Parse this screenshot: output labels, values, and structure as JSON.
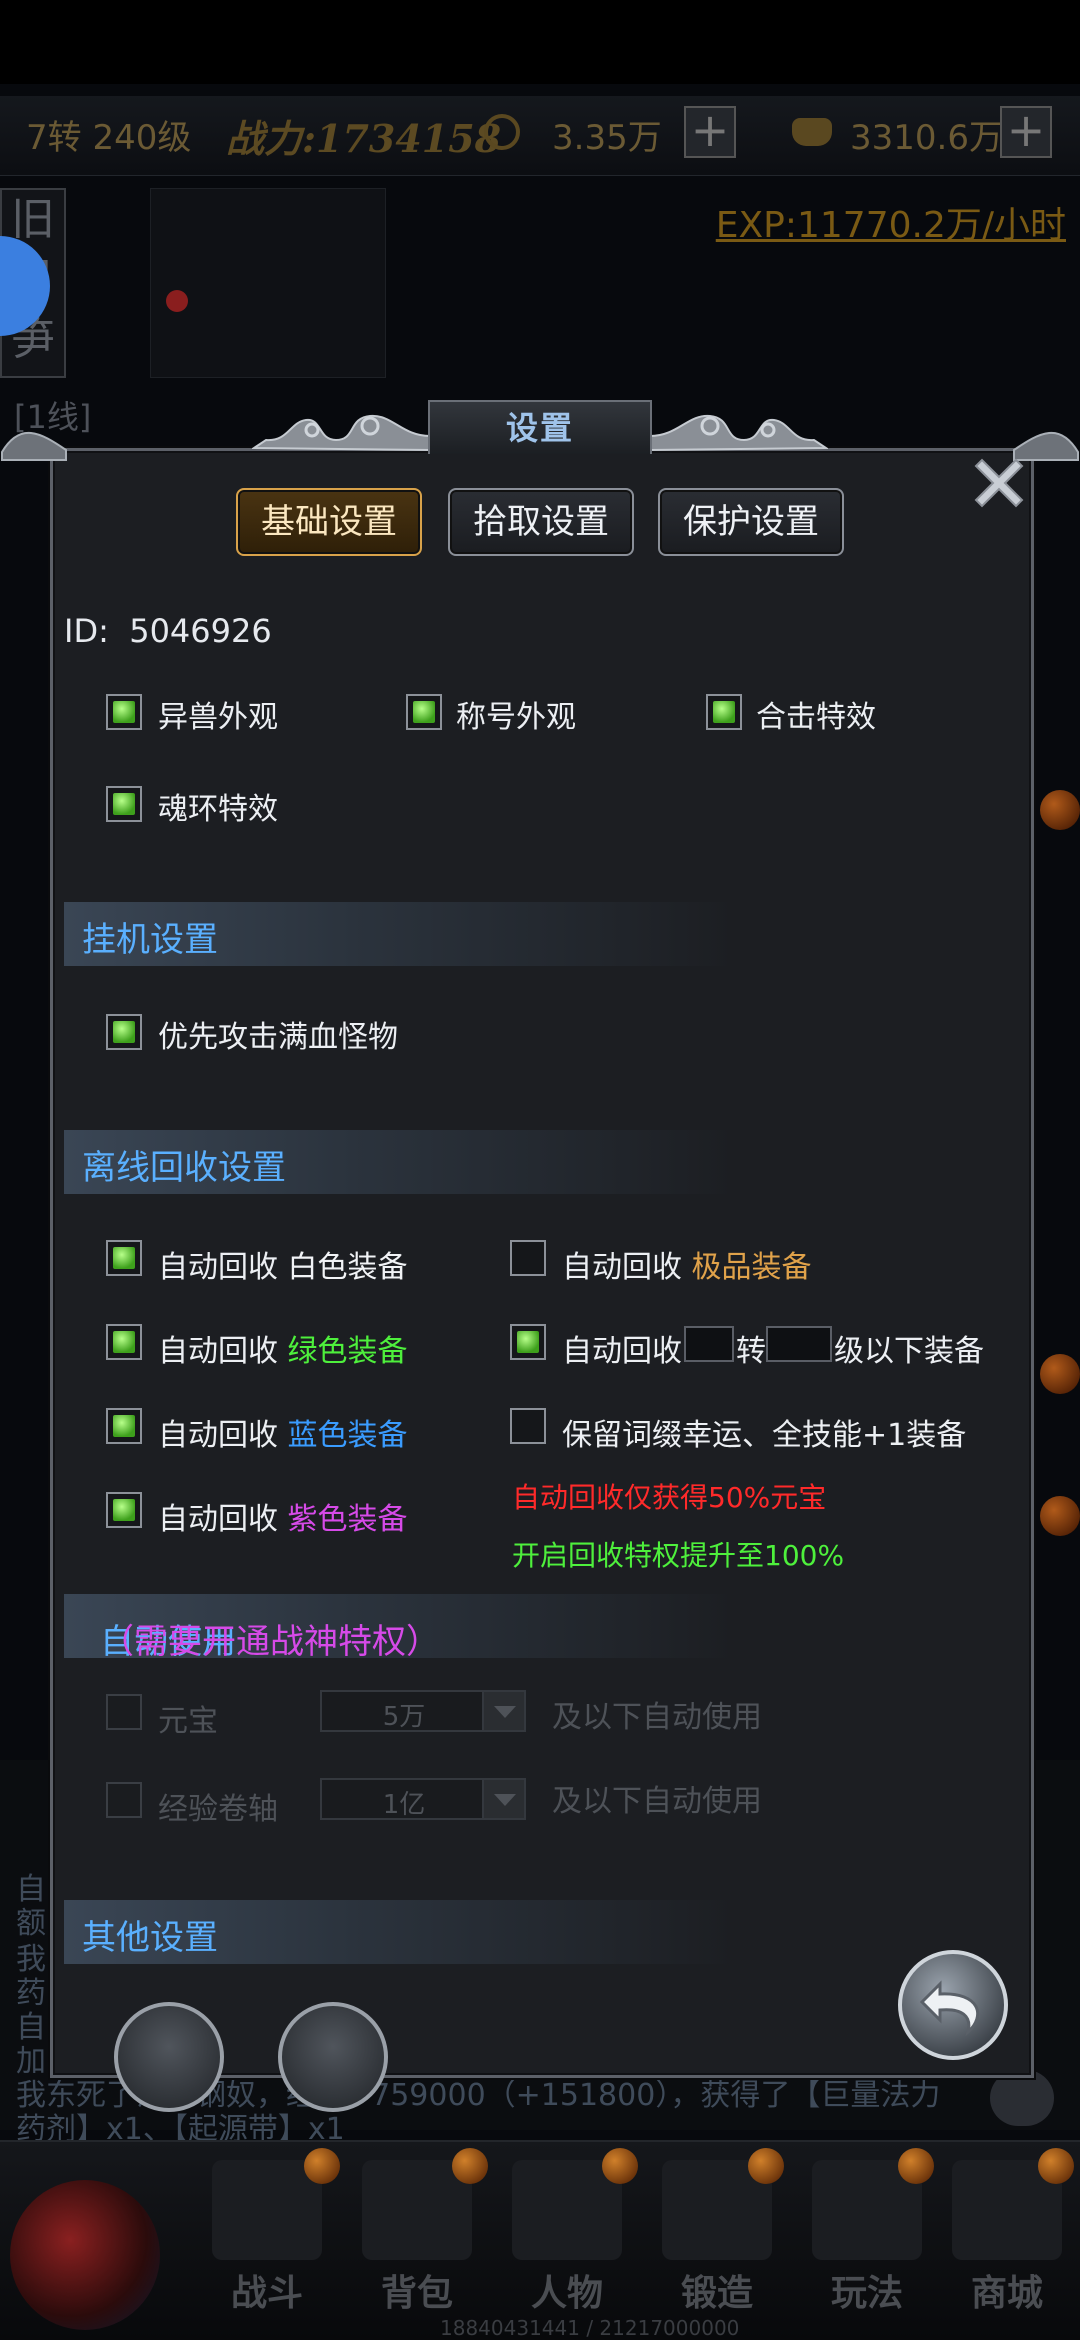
{
  "topbar": {
    "level": "7转 240级",
    "power": "战力:1734158",
    "currency1": "3.35万",
    "currency2": "3310.6万",
    "plus": "+"
  },
  "exp_rate": "EXP:11770.2万/小时",
  "side_tab": [
    "旧",
    "日",
    "笋"
  ],
  "line_label": "[1线]",
  "dialog": {
    "title": "设置",
    "tabs": [
      "基础设置",
      "拾取设置",
      "保护设置"
    ],
    "active_tab": 0,
    "id_label": "ID:",
    "id_value": "5046926",
    "display_options": [
      {
        "label": "异兽外观",
        "checked": true
      },
      {
        "label": "称号外观",
        "checked": true
      },
      {
        "label": "合击特效",
        "checked": true
      },
      {
        "label": "魂环特效",
        "checked": true
      }
    ],
    "afk": {
      "title": "挂机设置",
      "options": [
        {
          "label": "优先攻击满血怪物",
          "checked": true
        }
      ]
    },
    "offline": {
      "title": "离线回收设置",
      "auto_label": "自动回收",
      "left": [
        {
          "quality": "白色装备",
          "color": "#f1f3f6",
          "checked": true
        },
        {
          "quality": "绿色装备",
          "color": "#4ef03c",
          "checked": true
        },
        {
          "quality": "蓝色装备",
          "color": "#3a9cff",
          "checked": true
        },
        {
          "quality": "紫色装备",
          "color": "#d64ae8",
          "checked": true
        }
      ],
      "right_top": {
        "quality": "极品装备",
        "checked": false
      },
      "right_level": {
        "checked": true,
        "turn": "转",
        "suffix": "级以下装备"
      },
      "keep": {
        "label": "保留词缀幸运、全技能+1装备",
        "checked": false
      },
      "note_red": "自动回收仅获得50%元宝",
      "note_green": "开启回收特权提升至100%"
    },
    "auto_use": {
      "title": "自动使用",
      "title_note": "（需要开通战神特权）",
      "rows": [
        {
          "label": "元宝",
          "value": "5万",
          "suffix": "及以下自动使用",
          "checked": false
        },
        {
          "label": "经验卷轴",
          "value": "1亿",
          "suffix": "及以下自动使用",
          "checked": false
        }
      ]
    },
    "other": {
      "title": "其他设置"
    }
  },
  "chat": [
    "自",
    "额",
    "我",
    "药",
    "自",
    "加",
    "我东死了浩泽钢奴，经验+759000（+151800），获得了【巨量法力",
    "药剂】x1、【起源带】x1"
  ],
  "bottom_nav": [
    "战斗",
    "背包",
    "人物",
    "锻造",
    "玩法",
    "商城"
  ],
  "footer_text": "18840431441 / 21217000000",
  "colors": {
    "accent_gold": "#d8a24a",
    "section_blue": "#5ab0ff",
    "check_green": "#3ea01c"
  }
}
